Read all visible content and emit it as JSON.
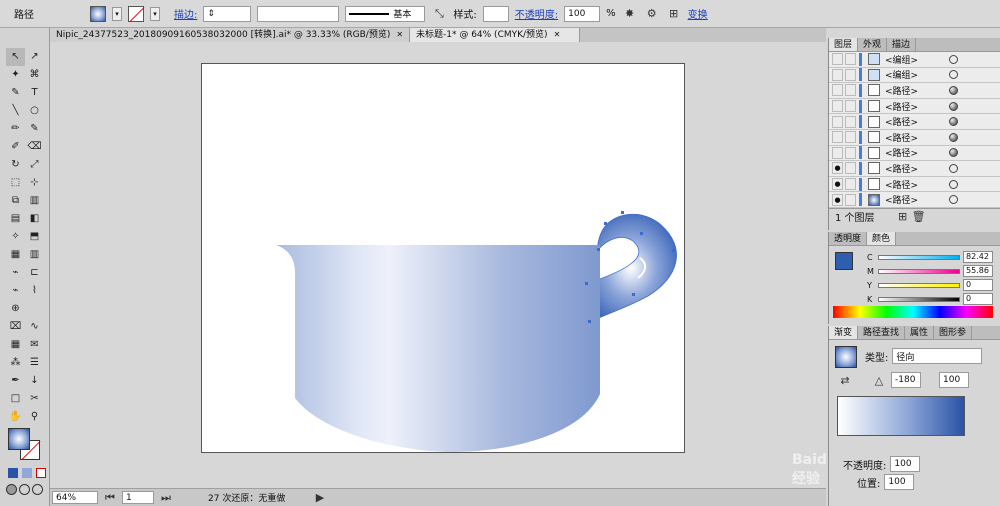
{
  "control": {
    "object_type": "路径",
    "stroke_label": "描边:",
    "brush_label": "基本",
    "style_label": "样式:",
    "opacity_label": "不透明度:",
    "opacity_value": "100",
    "opacity_unit": "%",
    "transform_label": "变换"
  },
  "tabs": [
    {
      "label": "Nipic_24377523_20180909160538032000 [转换].ai* @ 33.33% (RGB/预览)"
    },
    {
      "label": "未标题-1* @ 64% (CMYK/预览)"
    }
  ],
  "tools": [
    "↖",
    "↗",
    "✦",
    "⌘",
    "✎",
    "T",
    "╲",
    "○",
    "✏",
    "✎",
    "✐",
    "⌫",
    "↻",
    "⤢",
    "⬚",
    "⊹",
    "⧉",
    "▥",
    "▤",
    "◧",
    "✧",
    "⬒",
    "▦",
    "▥",
    "⌁",
    "⊏",
    "⌁",
    "⌇",
    "⊕",
    "",
    "⌧",
    "∿",
    "▦",
    "✉",
    "⁂",
    "☰",
    "✒",
    "↓",
    "□",
    "✂",
    "✋",
    "⚲"
  ],
  "status": {
    "zoom": "64%",
    "page": "1",
    "undo_text": "27 次还原：无重做"
  },
  "layers_panel": {
    "tabs": [
      "图层",
      "外观",
      "描边"
    ],
    "items": [
      {
        "name": "<编组>",
        "thumb": "group",
        "fill_target": false
      },
      {
        "name": "<编组>",
        "thumb": "group",
        "fill_target": false
      },
      {
        "name": "<路径>",
        "thumb": "path",
        "fill_target": true
      },
      {
        "name": "<路径>",
        "thumb": "path",
        "fill_target": true
      },
      {
        "name": "<路径>",
        "thumb": "path",
        "fill_target": true
      },
      {
        "name": "<路径>",
        "thumb": "path",
        "fill_target": true
      },
      {
        "name": "<路径>",
        "thumb": "path",
        "fill_target": true
      },
      {
        "name": "<路径>",
        "thumb": "path",
        "fill_target": false
      },
      {
        "name": "<路径>",
        "thumb": "path",
        "fill_target": false
      },
      {
        "name": "<路径>",
        "thumb": "grad",
        "fill_target": false
      }
    ],
    "footer": "1 个图层"
  },
  "color_panel": {
    "tabs": [
      "透明度",
      "颜色"
    ],
    "rows": [
      {
        "label": "C",
        "value": "82.42"
      },
      {
        "label": "M",
        "value": "55.86"
      },
      {
        "label": "Y",
        "value": "0"
      },
      {
        "label": "K",
        "value": "0"
      }
    ],
    "swatch_color": "#2e5fae"
  },
  "gradient_panel": {
    "tabs": [
      "渐变",
      "路径查找",
      "属性",
      "图形参"
    ],
    "type_label": "类型:",
    "type_value": "径向",
    "angle_value": "-180",
    "ratio_value": "100",
    "opacity_label": "不透明度:",
    "opacity_value": "100",
    "location_label": "位置:",
    "location_value": "100"
  },
  "watermark_text": "Baidu 经验"
}
